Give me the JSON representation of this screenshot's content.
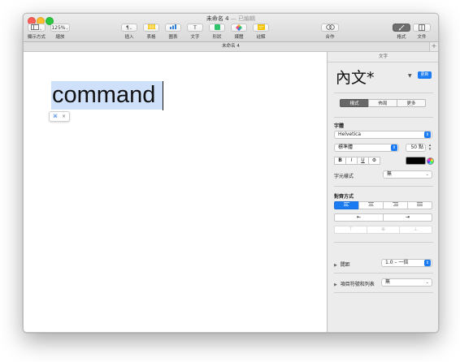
{
  "window": {
    "title": "未命名 4",
    "title_sep": " — ",
    "status": "已編輯",
    "tab_label": "未命名 4",
    "tab_plus": "+"
  },
  "toolbar": {
    "view_label": "顯示方式",
    "zoom_value": "125%",
    "zoom_label": "縮放",
    "insert_glyph": "¶",
    "insert_label": "插入",
    "table_label": "表格",
    "chart_label": "圖表",
    "text_glyph": "T",
    "text_label": "文字",
    "shape_label": "形狀",
    "media_label": "媒體",
    "comment_label": "註解",
    "collaborate_label": "合作",
    "format_label": "格式",
    "document_label": "文件",
    "colors": {
      "table": "#f5c400",
      "chart": "#2f7fd8",
      "shape": "#2fc36c",
      "media": "#e24d7c",
      "comment": "#f5c400"
    }
  },
  "canvas": {
    "typed_word": "command",
    "popup_icon": "⌘",
    "popup_close": "×"
  },
  "inspector": {
    "header": "文字",
    "style_name": "內文*",
    "update_label": "更新",
    "tabs": [
      "樣式",
      "佈局",
      "更多"
    ],
    "selected_tab": "樣式",
    "font_section": "字體",
    "font_family": "Helvetica",
    "font_weight": "標準體",
    "font_size": "50 點",
    "bold": "B",
    "italic": "I",
    "underline": "U",
    "gear": "⚙",
    "text_color": "#000000",
    "char_style_label": "字元樣式",
    "char_style_value": "無",
    "alignment_section": "對齊方式",
    "indent_decrease": "⇤",
    "indent_increase": "⇥",
    "spacing_label": "間距",
    "spacing_value": "1.0 – 一倍",
    "bullets_label": "項目符號和列表",
    "bullets_value": "無",
    "accent": "#1a7bf2"
  }
}
